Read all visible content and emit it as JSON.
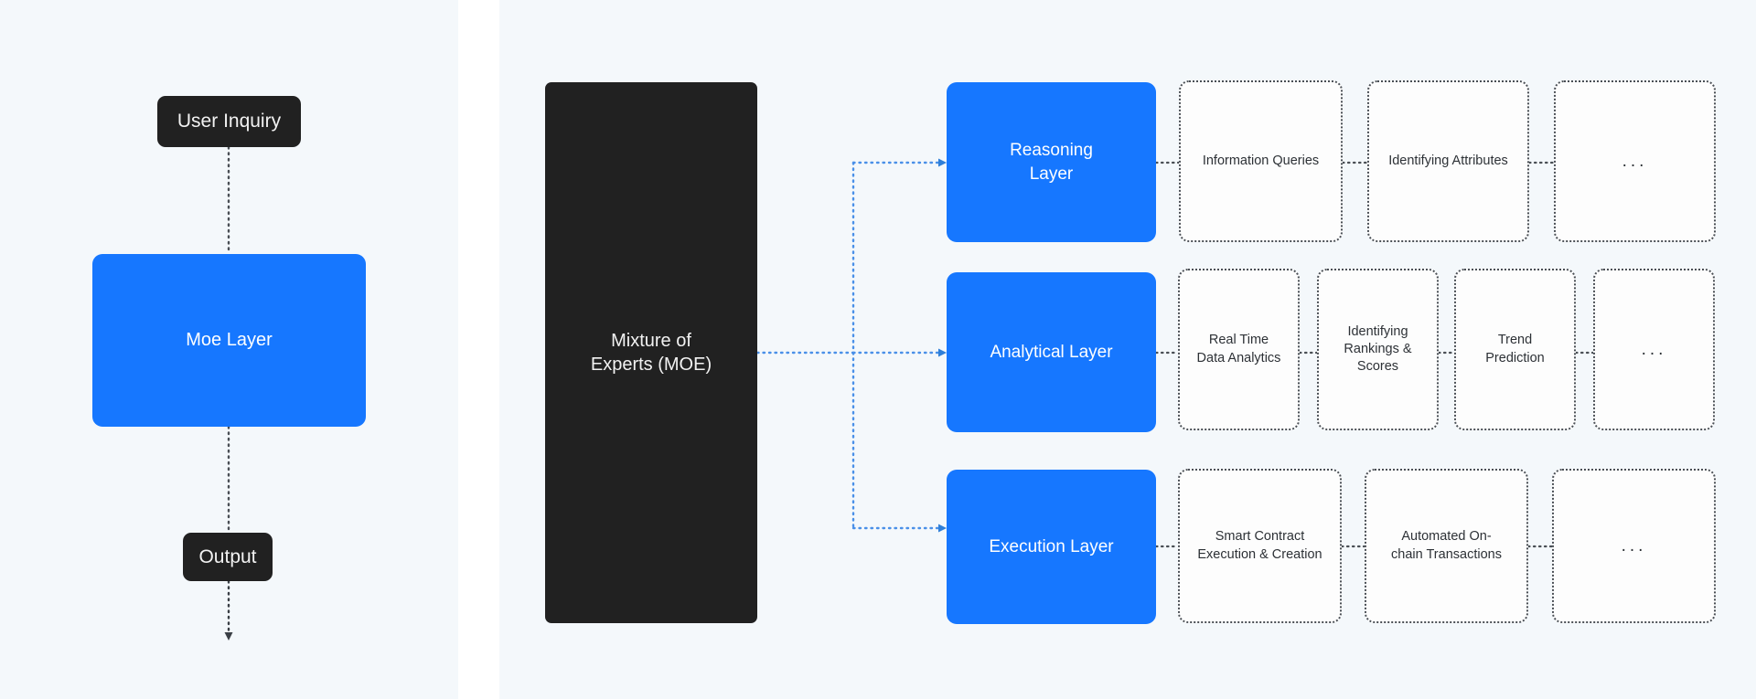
{
  "theme": {
    "panel_bg": "#f4f8fb",
    "page_bg": "#ffffff",
    "accent_blue": "#1677ff",
    "dark": "#212121",
    "card_bg": "#fdfdfd",
    "card_border": "#4a4f55",
    "wire_gray": "#4a4f55",
    "wire_blue": "#4a90e8",
    "text_light": "#ffffff",
    "text_dark": "#2d3136"
  },
  "left_panel": {
    "nodes": {
      "user_inquiry": "User Inquiry",
      "moe_layer": "Moe Layer",
      "output": "Output"
    }
  },
  "right_panel": {
    "root": {
      "line1": "Mixture of",
      "line2": "Experts (MOE)"
    },
    "layers": [
      {
        "label_line1": "Reasoning",
        "label_line2": "Layer",
        "cards": [
          {
            "line1": "Information Queries",
            "line2": ""
          },
          {
            "line1": "Identifying Attributes",
            "line2": ""
          },
          {
            "line1": "...",
            "line2": ""
          }
        ]
      },
      {
        "label_line1": "Analytical Layer",
        "label_line2": "",
        "cards": [
          {
            "line1": "Real Time",
            "line2": "Data Analytics"
          },
          {
            "line1": "Identifying",
            "line2": "Rankings &",
            "line3": "Scores"
          },
          {
            "line1": "Trend",
            "line2": "Prediction"
          },
          {
            "line1": "...",
            "line2": ""
          }
        ]
      },
      {
        "label_line1": "Execution Layer",
        "label_line2": "",
        "cards": [
          {
            "line1": "Smart Contract",
            "line2": "Execution & Creation"
          },
          {
            "line1": "Automated On-",
            "line2": "chain Transactions"
          },
          {
            "line1": "...",
            "line2": ""
          }
        ]
      }
    ]
  }
}
